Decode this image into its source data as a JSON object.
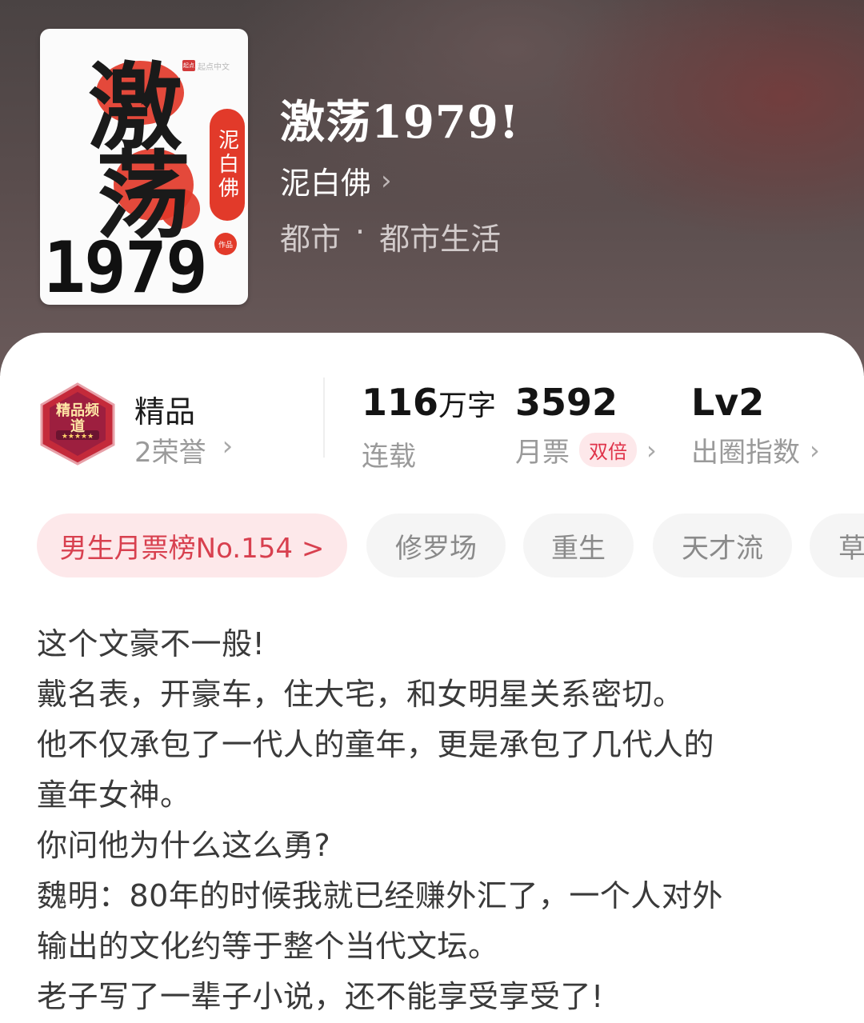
{
  "book": {
    "title": "激荡1979!",
    "author": "泥白佛",
    "author_chevron": "›",
    "genre_main": "都市",
    "genre_sep": "·",
    "genre_sub": "都市生活"
  },
  "cover": {
    "char1": "激",
    "char2": "荡",
    "year": "1979",
    "seal_text": "泥白佛",
    "small_seal": "作品",
    "publisher_tag": "起点中文"
  },
  "stats": {
    "quality": {
      "title": "精品",
      "honors": "2荣誉",
      "chevron": "›",
      "emblem_label": "精品频道"
    },
    "words": {
      "value": "116",
      "unit": "万字",
      "label": "连载"
    },
    "monthly_tickets": {
      "value": "3592",
      "label": "月票",
      "pill": "双倍",
      "chevron": "›"
    },
    "influence": {
      "value": "Lv2",
      "label": "出圈指数",
      "chevron": "›"
    }
  },
  "tags": [
    {
      "label": "男生月票榜No.154 >",
      "type": "rank"
    },
    {
      "label": "修罗场",
      "type": "normal"
    },
    {
      "label": "重生",
      "type": "normal"
    },
    {
      "label": "天才流",
      "type": "normal"
    },
    {
      "label": "草",
      "type": "normal"
    }
  ],
  "synopsis": [
    "这个文豪不一般!",
    "戴名表，开豪车，住大宅，和女明星关系密切。",
    "他不仅承包了一代人的童年，更是承包了几代人的",
    "童年女神。",
    "你问他为什么这么勇?",
    "魏明：80年的时候我就已经赚外汇了，一个人对外",
    "输出的文化约等于整个当代文坛。",
    "老子写了一辈子小说，还不能享受享受了!"
  ],
  "colors": {
    "accent": "#d8404f",
    "accent_bg": "#fde8ea",
    "cover_red": "#e23a2a"
  }
}
